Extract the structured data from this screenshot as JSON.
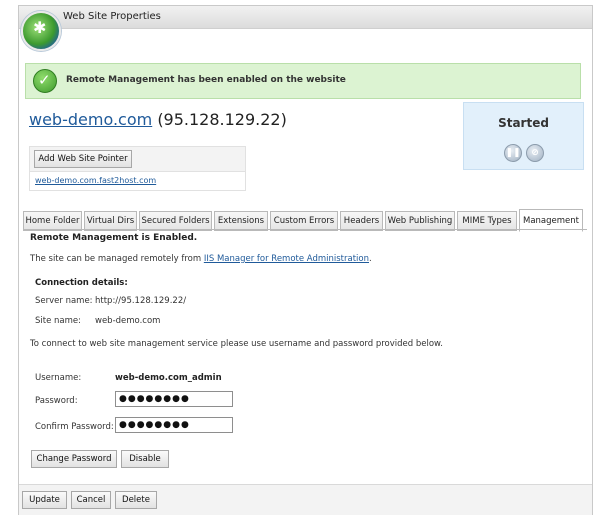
{
  "window": {
    "title": "Web Site Properties"
  },
  "alert": {
    "message": "Remote Management has been enabled on the website"
  },
  "site": {
    "domain": "web-demo.com",
    "ip": "(95.128.129.22)",
    "add_pointer_label": "Add Web Site Pointer",
    "pointer_link": "web-demo.com.fast2host.com"
  },
  "status": {
    "label": "Started"
  },
  "tabs": [
    {
      "label": "Home Folder"
    },
    {
      "label": "Virtual Dirs"
    },
    {
      "label": "Secured Folders"
    },
    {
      "label": "Extensions"
    },
    {
      "label": "Custom Errors"
    },
    {
      "label": "Headers"
    },
    {
      "label": "Web Publishing"
    },
    {
      "label": "MIME Types"
    },
    {
      "label": "Management",
      "active": true
    }
  ],
  "management": {
    "heading": "Remote Management is Enabled.",
    "intro_prefix": "The site can be managed remotely from ",
    "intro_link": "IIS Manager for Remote Administration",
    "intro_suffix": ".",
    "details_heading": "Connection details:",
    "server_name_label": "Server name:",
    "server_name_value": "http://95.128.129.22/",
    "site_name_label": "Site name:",
    "site_name_value": "web-demo.com",
    "instructions": "To connect to web site management service please use username and password provided below.",
    "username_label": "Username:",
    "username_value": "web-demo.com_admin",
    "password_label": "Password:",
    "password_value": "●●●●●●●●",
    "confirm_label": "Confirm Password:",
    "confirm_value": "●●●●●●●●",
    "change_password_label": "Change Password",
    "disable_label": "Disable"
  },
  "footer": {
    "update_label": "Update",
    "cancel_label": "Cancel",
    "delete_label": "Delete"
  },
  "colors": {
    "accent_link": "#1f5a9a",
    "alert_bg": "#dcf3d2",
    "status_bg": "#e2f0fb"
  },
  "icons": {
    "window_icon": "globe-icon",
    "alert_icon": "check-circle-icon",
    "pause": "pause-icon",
    "stop": "stop-icon"
  }
}
